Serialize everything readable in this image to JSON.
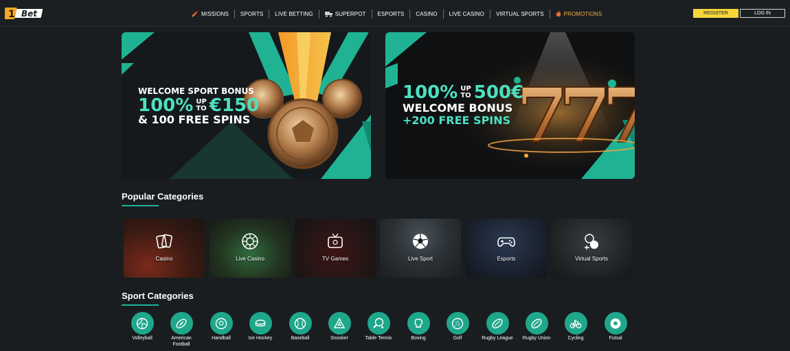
{
  "brand": {
    "logo_text": "Bet",
    "logo_number": "1"
  },
  "nav": [
    {
      "label": "MISSIONS",
      "icon": "rocket-icon"
    },
    {
      "label": "SPORTS"
    },
    {
      "label": "LIVE BETTING"
    },
    {
      "label": "SUPERPOT",
      "icon": "truck-icon"
    },
    {
      "label": "ESPORTS"
    },
    {
      "label": "CASINO"
    },
    {
      "label": "LIVE CASINO"
    },
    {
      "label": "VIRTUAL SPORTS"
    },
    {
      "label": "PROMOTIONS",
      "icon": "fire-icon"
    }
  ],
  "auth": {
    "register": "REGISTER",
    "login": "LOG IN"
  },
  "banners": {
    "sport": {
      "line1": "WELCOME SPORT BONUS",
      "percent": "100%",
      "up": "UP",
      "to": "TO",
      "amount": "€150",
      "line3": "& 100 FREE SPINS"
    },
    "casino": {
      "percent": "100%",
      "up": "UP",
      "to": "TO",
      "amount": "500€",
      "line2": "WELCOME BONUS",
      "line3": "+200 FREE SPINS"
    }
  },
  "popular": {
    "title": "Popular Categories",
    "items": [
      {
        "label": "Casino",
        "icon": "cards-icon"
      },
      {
        "label": "Live Casino",
        "icon": "roulette-icon"
      },
      {
        "label": "TV Games",
        "icon": "tv-icon"
      },
      {
        "label": "Live Sport",
        "icon": "soccer-ball-icon"
      },
      {
        "label": "Esports",
        "icon": "gamepad-icon"
      },
      {
        "label": "Virtual Sports",
        "icon": "virtual-sports-icon"
      }
    ]
  },
  "sports": {
    "title": "Sport Categories",
    "items": [
      {
        "label": "Volleyball"
      },
      {
        "label": "American Football"
      },
      {
        "label": "Handball"
      },
      {
        "label": "Ice Hockey"
      },
      {
        "label": "Baseball"
      },
      {
        "label": "Snooker"
      },
      {
        "label": "Table Tennis"
      },
      {
        "label": "Boxing"
      },
      {
        "label": "Golf"
      },
      {
        "label": "Rugby League"
      },
      {
        "label": "Rugby Union"
      },
      {
        "label": "Cycling"
      },
      {
        "label": "Futsal"
      }
    ]
  },
  "colors": {
    "accent": "#1fa78c",
    "highlight": "#4ce0c1",
    "register": "#f5d63b",
    "promo": "#f0b04a",
    "background": "#1a1d1f"
  }
}
